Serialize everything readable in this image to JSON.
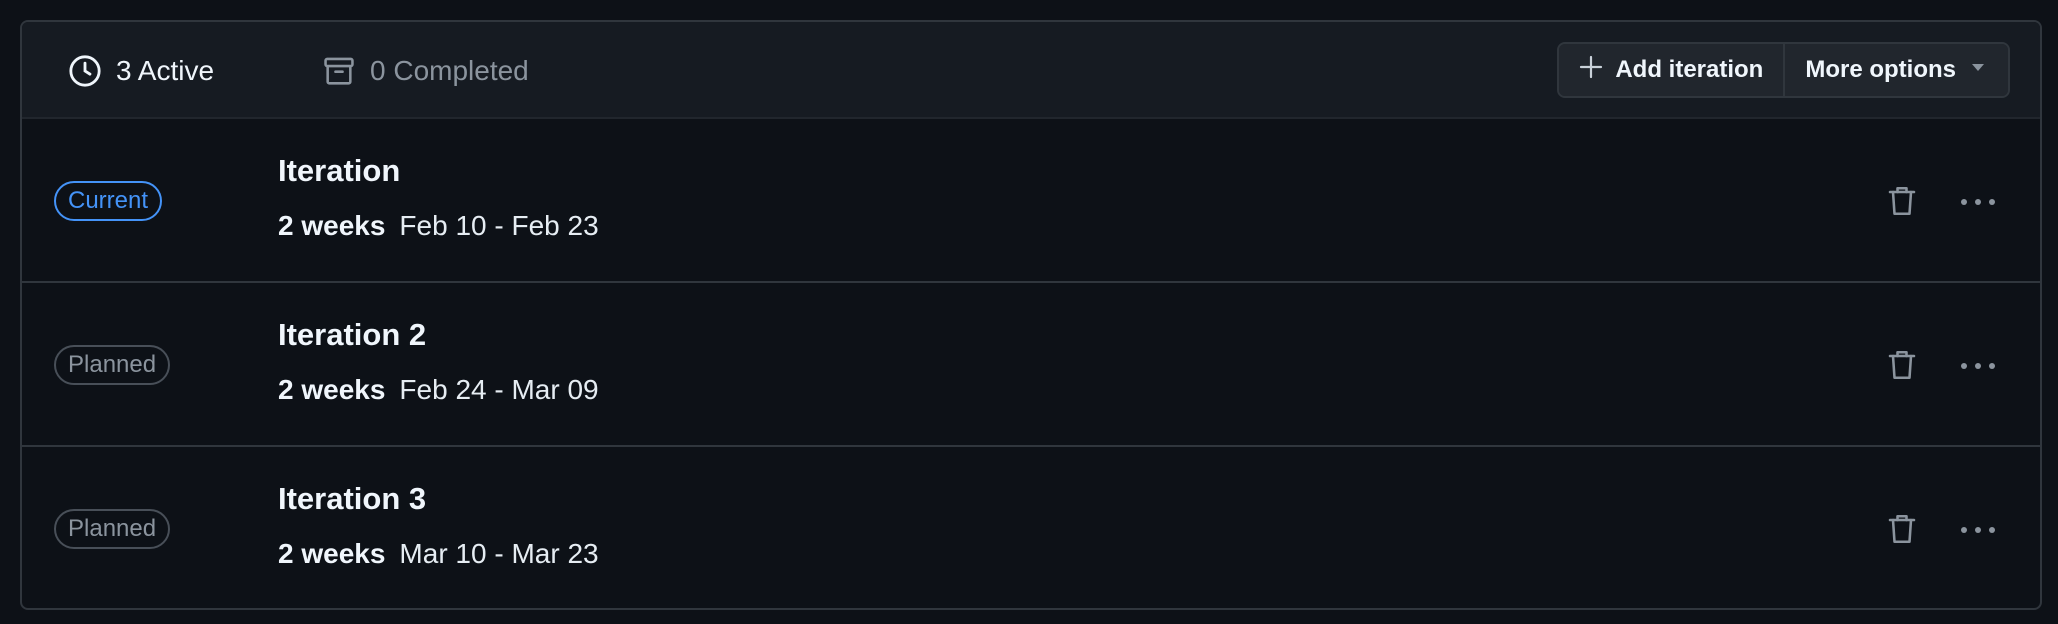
{
  "filters": {
    "active_label": "3 Active",
    "completed_label": "0 Completed"
  },
  "toolbar": {
    "add_label": "Add iteration",
    "more_label": "More options"
  },
  "iterations": [
    {
      "status": "Current",
      "name": "Iteration",
      "duration": "2 weeks",
      "range": "Feb 10 - Feb 23"
    },
    {
      "status": "Planned",
      "name": "Iteration 2",
      "duration": "2 weeks",
      "range": "Feb 24 - Mar 09"
    },
    {
      "status": "Planned",
      "name": "Iteration 3",
      "duration": "2 weeks",
      "range": "Mar 10 - Mar 23"
    }
  ],
  "colors": {
    "background": "#0d1117",
    "toolbar": "#161b22",
    "accent": "#4493f8",
    "border": "#30363d",
    "muted": "#8b949e"
  },
  "icons": [
    "clock-icon",
    "archive-icon",
    "plus-icon",
    "triangle-down-icon",
    "trash-icon",
    "kebab-horizontal-icon"
  ]
}
